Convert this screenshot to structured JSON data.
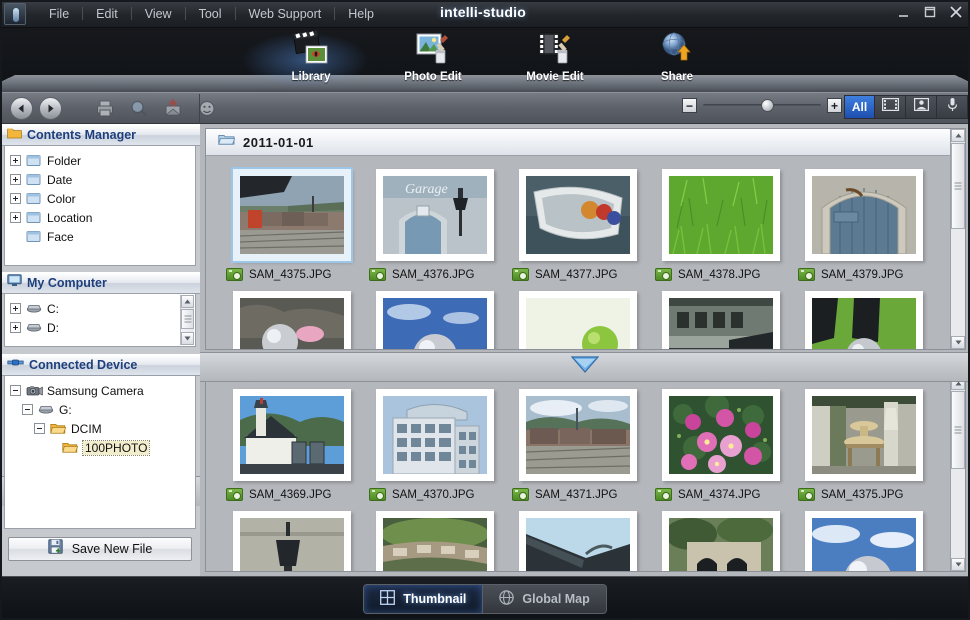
{
  "window": {
    "title": "intelli-studio",
    "title_plain": "intelli",
    "title_suffix": "studio",
    "app_icon": "app-logo-icon",
    "minimize_label": "Minimize",
    "maximize_label": "Maximize",
    "close_label": "Close"
  },
  "menubar": {
    "items": [
      {
        "label": "File"
      },
      {
        "label": "Edit"
      },
      {
        "label": "View"
      },
      {
        "label": "Tool"
      },
      {
        "label": "Web Support"
      },
      {
        "label": "Help"
      }
    ]
  },
  "modebar": {
    "modes": [
      {
        "label": "Library",
        "icon": "library-icon",
        "active": true
      },
      {
        "label": "Photo Edit",
        "icon": "photo-edit-icon",
        "active": false
      },
      {
        "label": "Movie Edit",
        "icon": "movie-edit-icon",
        "active": false
      },
      {
        "label": "Share",
        "icon": "share-icon",
        "active": false
      }
    ]
  },
  "toolbar": {
    "back_label": "Back",
    "forward_label": "Forward",
    "icons": [
      {
        "name": "print-icon",
        "label": "Print"
      },
      {
        "name": "search-icon",
        "label": "Search"
      },
      {
        "name": "add-to-album-icon",
        "label": "Add to album"
      },
      {
        "name": "face-icon",
        "label": "Face recognition"
      }
    ],
    "zoom": {
      "minus_label": "−",
      "plus_label": "+",
      "value": 50
    },
    "filters": [
      {
        "label": "All",
        "name": "filter-all",
        "active": true
      },
      {
        "label": "",
        "name": "filter-video",
        "icon": "film-icon",
        "active": false
      },
      {
        "label": "",
        "name": "filter-photo",
        "icon": "photo-icon",
        "active": false
      },
      {
        "label": "",
        "name": "filter-voice",
        "icon": "microphone-icon",
        "active": false
      }
    ]
  },
  "sidebar": {
    "contents_manager": {
      "title": "Contents Manager",
      "icon": "folder-icon",
      "items": [
        {
          "label": "Folder",
          "expandable": true,
          "icon": "library-node-icon"
        },
        {
          "label": "Date",
          "expandable": true,
          "icon": "library-node-icon"
        },
        {
          "label": "Color",
          "expandable": true,
          "icon": "library-node-icon"
        },
        {
          "label": "Location",
          "expandable": true,
          "icon": "library-node-icon"
        },
        {
          "label": "Face",
          "expandable": false,
          "icon": "library-node-icon"
        }
      ]
    },
    "my_computer": {
      "title": "My Computer",
      "icon": "monitor-icon",
      "items": [
        {
          "label": "C:",
          "expandable": true,
          "icon": "drive-icon"
        },
        {
          "label": "D:",
          "expandable": true,
          "icon": "drive-icon"
        }
      ]
    },
    "connected_device": {
      "title": "Connected Device",
      "icon": "usb-icon",
      "items": [
        {
          "label": "Samsung Camera",
          "depth": 0,
          "expandable": true,
          "expanded": true,
          "icon": "camera-icon",
          "selected": false
        },
        {
          "label": "G:",
          "depth": 1,
          "expandable": true,
          "expanded": true,
          "icon": "drive-icon",
          "selected": false
        },
        {
          "label": "DCIM",
          "depth": 2,
          "expandable": true,
          "expanded": true,
          "icon": "folder-open-icon",
          "selected": false
        },
        {
          "label": "100PHOTO",
          "depth": 3,
          "expandable": false,
          "expanded": false,
          "icon": "folder-open-icon",
          "selected": true
        }
      ],
      "save_button": "Save New File",
      "save_icon": "save-icon"
    }
  },
  "main": {
    "top_pane": {
      "group_header": "2011-01-01",
      "group_icon": "folder-open-icon",
      "rows": [
        [
          {
            "name": "SAM_4375.JPG",
            "selected": true,
            "art": "train"
          },
          {
            "name": "SAM_4376.JPG",
            "selected": false,
            "art": "garage"
          },
          {
            "name": "SAM_4377.JPG",
            "selected": false,
            "art": "boat"
          },
          {
            "name": "SAM_4378.JPG",
            "selected": false,
            "art": "grass"
          },
          {
            "name": "SAM_4379.JPG",
            "selected": false,
            "art": "bluedoor"
          }
        ],
        [
          {
            "name": "",
            "selected": false,
            "art": "rockball"
          },
          {
            "name": "",
            "selected": false,
            "art": "skyball"
          },
          {
            "name": "",
            "selected": false,
            "art": "greenball"
          },
          {
            "name": "",
            "selected": false,
            "art": "building2"
          },
          {
            "name": "",
            "selected": false,
            "art": "lawnball"
          }
        ]
      ]
    },
    "bottom_pane": {
      "rows": [
        [
          {
            "name": "SAM_4369.JPG",
            "selected": false,
            "art": "house"
          },
          {
            "name": "SAM_4370.JPG",
            "selected": false,
            "art": "building"
          },
          {
            "name": "SAM_4371.JPG",
            "selected": false,
            "art": "train2"
          },
          {
            "name": "SAM_4374.JPG",
            "selected": false,
            "art": "flowers"
          },
          {
            "name": "SAM_4375.JPG",
            "selected": false,
            "art": "fountain"
          }
        ],
        [
          {
            "name": "",
            "selected": false,
            "art": "lamp"
          },
          {
            "name": "",
            "selected": false,
            "art": "gardenwall"
          },
          {
            "name": "",
            "selected": false,
            "art": "roof"
          },
          {
            "name": "",
            "selected": false,
            "art": "arches"
          },
          {
            "name": "",
            "selected": false,
            "art": "skyball2"
          }
        ]
      ]
    },
    "splitter_icon": "collapse-down-icon"
  },
  "bottombar": {
    "views": [
      {
        "label": "Thumbnail",
        "icon": "grid-icon",
        "active": true
      },
      {
        "label": "Global Map",
        "icon": "globe-icon",
        "active": false
      }
    ]
  },
  "colors": {
    "accent_blue": "#1d4fae",
    "brand_text": "#ffffff",
    "panel_title": "#1e3f7d",
    "camera_badge_green": "#5e9a2e",
    "selection_highlight": "#f2eecd",
    "chrome_dark": "#16181c",
    "chrome_gray": "#b4b7bc"
  }
}
